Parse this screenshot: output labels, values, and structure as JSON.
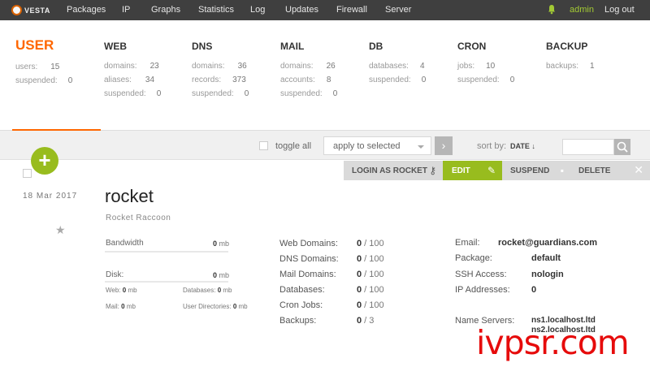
{
  "topbar": {
    "logo_text": "VESTA",
    "nav": [
      "Packages",
      "IP",
      "Graphs",
      "Statistics",
      "Log",
      "Updates",
      "Firewall",
      "Server"
    ],
    "user": "admin",
    "logout": "Log out",
    "accent_color": "#ff6701"
  },
  "stats": {
    "user": {
      "title": "USER",
      "rows": [
        {
          "label": "users:",
          "value": "15"
        },
        {
          "label": "suspended:",
          "value": "0"
        }
      ]
    },
    "web": {
      "title": "WEB",
      "rows": [
        {
          "label": "domains:",
          "value": "23"
        },
        {
          "label": "aliases:",
          "value": "34"
        },
        {
          "label": "suspended:",
          "value": "0"
        }
      ]
    },
    "dns": {
      "title": "DNS",
      "rows": [
        {
          "label": "domains:",
          "value": "36"
        },
        {
          "label": "records:",
          "value": "373"
        },
        {
          "label": "suspended:",
          "value": "0"
        }
      ]
    },
    "mail": {
      "title": "MAIL",
      "rows": [
        {
          "label": "domains:",
          "value": "26"
        },
        {
          "label": "accounts:",
          "value": "8"
        },
        {
          "label": "suspended:",
          "value": "0"
        }
      ]
    },
    "db": {
      "title": "DB",
      "rows": [
        {
          "label": "databases:",
          "value": "4"
        },
        {
          "label": "suspended:",
          "value": "0"
        }
      ]
    },
    "cron": {
      "title": "CRON",
      "rows": [
        {
          "label": "jobs:",
          "value": "10"
        },
        {
          "label": "suspended:",
          "value": "0"
        }
      ]
    },
    "backup": {
      "title": "BACKUP",
      "rows": [
        {
          "label": "backups:",
          "value": "1"
        }
      ]
    }
  },
  "toolbar": {
    "toggle_all": "toggle all",
    "apply_selected": "apply to selected",
    "go_symbol": "›",
    "sort_label": "sort by:",
    "sort_value": "DATE ↓",
    "add_symbol": "+"
  },
  "actions": {
    "login": "LOGIN AS ROCKET",
    "edit": "EDIT",
    "suspend": "SUSPEND",
    "delete": "DELETE"
  },
  "account": {
    "date": "18 Mar 2017",
    "username": "rocket",
    "fullname": "Rocket Raccoon",
    "bandwidth_label": "Bandwidth",
    "bandwidth_value": "0",
    "disk_label": "Disk:",
    "disk_value": "0",
    "unit": "mb",
    "web_label": "Web:",
    "web_value": "0",
    "databases_label": "Databases:",
    "databases_value": "0",
    "mail_label": "Mail:",
    "mail_value": "0",
    "userdirs_label": "User Directories:",
    "userdirs_value": "0",
    "limits": [
      {
        "label": "Web Domains:",
        "used": "0",
        "max": "100"
      },
      {
        "label": "DNS Domains:",
        "used": "0",
        "max": "100"
      },
      {
        "label": "Mail Domains:",
        "used": "0",
        "max": "100"
      },
      {
        "label": "Databases:",
        "used": "0",
        "max": "100"
      },
      {
        "label": "Cron Jobs:",
        "used": "0",
        "max": "100"
      },
      {
        "label": "Backups:",
        "used": "0",
        "max": "3"
      }
    ],
    "info": {
      "email_label": "Email:",
      "email": "rocket@guardians.com",
      "package_label": "Package:",
      "package": "default",
      "ssh_label": "SSH Access:",
      "ssh": "nologin",
      "ip_label": "IP Addresses:",
      "ip": "0",
      "ns_label": "Name Servers:",
      "ns1": "ns1.localhost.ltd",
      "ns2": "ns2.localhost.ltd"
    }
  },
  "watermark": "ivpsr.com"
}
